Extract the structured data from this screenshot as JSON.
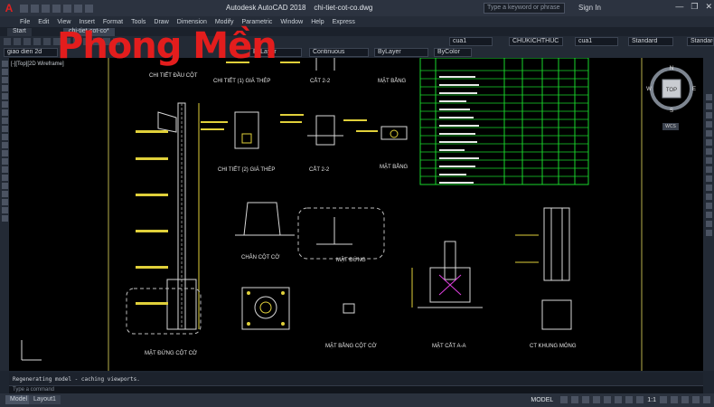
{
  "titlebar": {
    "app_logo": "A",
    "title": "Autodesk AutoCAD 2018    chi-tiet-cot-co.dwg",
    "search_placeholder": "Type a keyword or phrase",
    "signin": "Sign In",
    "window_controls": [
      "—",
      "❐",
      "✕"
    ]
  },
  "menu": [
    "File",
    "Edit",
    "View",
    "Insert",
    "Format",
    "Tools",
    "Draw",
    "Dimension",
    "Modify",
    "Parametric",
    "Window",
    "Help",
    "Express"
  ],
  "tabs": [
    "Start",
    "chi-tiet-cot-co*"
  ],
  "toolbar": {
    "workspace": "giao dien 2d",
    "color": "ByLayer",
    "linetype": "Continuous",
    "lineweight": "ByLayer",
    "plotstyle": "ByColor",
    "layer_a": "cua1",
    "text_style": "CHUKICHTHUC",
    "layer_b": "cua1",
    "dim_style": "Standard",
    "table_style": "Standard"
  },
  "viewport": {
    "label": "[-][Top][2D Wireframe]"
  },
  "brand": "Phong Mền",
  "viewcube": {
    "face": "TOP",
    "n": "N",
    "s": "S",
    "e": "E",
    "w": "W",
    "wcs": "WCS"
  },
  "drawing_labels": {
    "chi_tiet_dau_cot": "CHI TIẾT ĐẦU CỘT",
    "chi_tiet_gia_thep_1": "CHI TIẾT (1) GIÁ THÉP",
    "cat_2_2_top": "CẮT 2-2",
    "mat_bang_top": "MẶT BẰNG",
    "chi_tiet_gia_thep_2": "CHI TIẾT (2) GIÁ THÉP",
    "cat_2_2": "CẮT 2-2",
    "mat_bang": "MẶT BẰNG",
    "chan_cot_co": "CHÂN CỘT CỜ",
    "mat_dung": "MẶT ĐỨNG",
    "mat_dung_cot_co": "MẶT ĐỨNG CỘT CỜ",
    "mat_bang_cot_co": "MẶT BẰNG CỘT CỜ",
    "mat_cat_a_a": "MẶT CẮT A-A",
    "ct_khung_mong": "CT KHUNG MÓNG"
  },
  "command": {
    "history": "Regenerating model - caching viewports.",
    "prompt": "Type a command"
  },
  "statusbar": {
    "layouts": [
      "Model",
      "Layout1"
    ],
    "model_label": "MODEL",
    "scale": "1:1"
  }
}
